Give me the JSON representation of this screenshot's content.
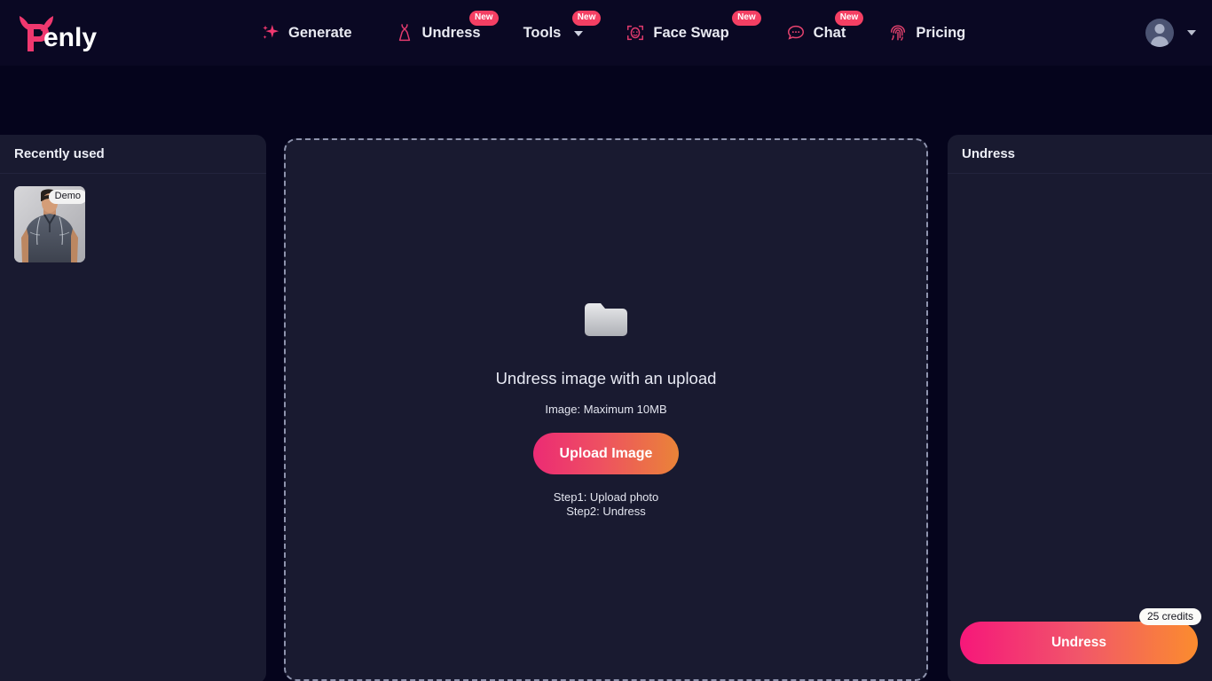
{
  "brand": {
    "name": "Penly"
  },
  "header": {
    "nav": [
      {
        "label": "Generate",
        "icon": "sparkle-icon",
        "badge": null,
        "caret": false
      },
      {
        "label": "Undress",
        "icon": "dress-icon",
        "badge": "New",
        "caret": false
      },
      {
        "label": "Tools",
        "icon": null,
        "badge": "New",
        "caret": true
      },
      {
        "label": "Face Swap",
        "icon": "face-scan-icon",
        "badge": "New",
        "caret": false
      },
      {
        "label": "Chat",
        "icon": "chat-bubble-icon",
        "badge": "New",
        "caret": false
      },
      {
        "label": "Pricing",
        "icon": "fingerprint-icon",
        "badge": null,
        "caret": false
      }
    ],
    "account": {
      "icon": "user-avatar-icon",
      "caret": "chevron-down-icon"
    }
  },
  "sidebar": {
    "title": "Recently used",
    "items": [
      {
        "badge": "Demo",
        "alt": "Man in gray athletic t-shirt"
      }
    ]
  },
  "dropzone": {
    "icon": "folder-icon",
    "title": "Undress image with an upload",
    "subtitle": "Image: Maximum 10MB",
    "upload_button": "Upload Image",
    "step1": "Step1: Upload photo",
    "step2": "Step2: Undress"
  },
  "right_panel": {
    "title": "Undress",
    "action_button": "Undress",
    "credits_badge": "25 credits"
  },
  "colors": {
    "page_bg": "#05041c",
    "panel_bg": "#191a30",
    "header_bg": "#0a0823",
    "accent_pink": "#f6177a",
    "accent_orange": "#fb8c2e",
    "badge_new": "#f43f63"
  }
}
